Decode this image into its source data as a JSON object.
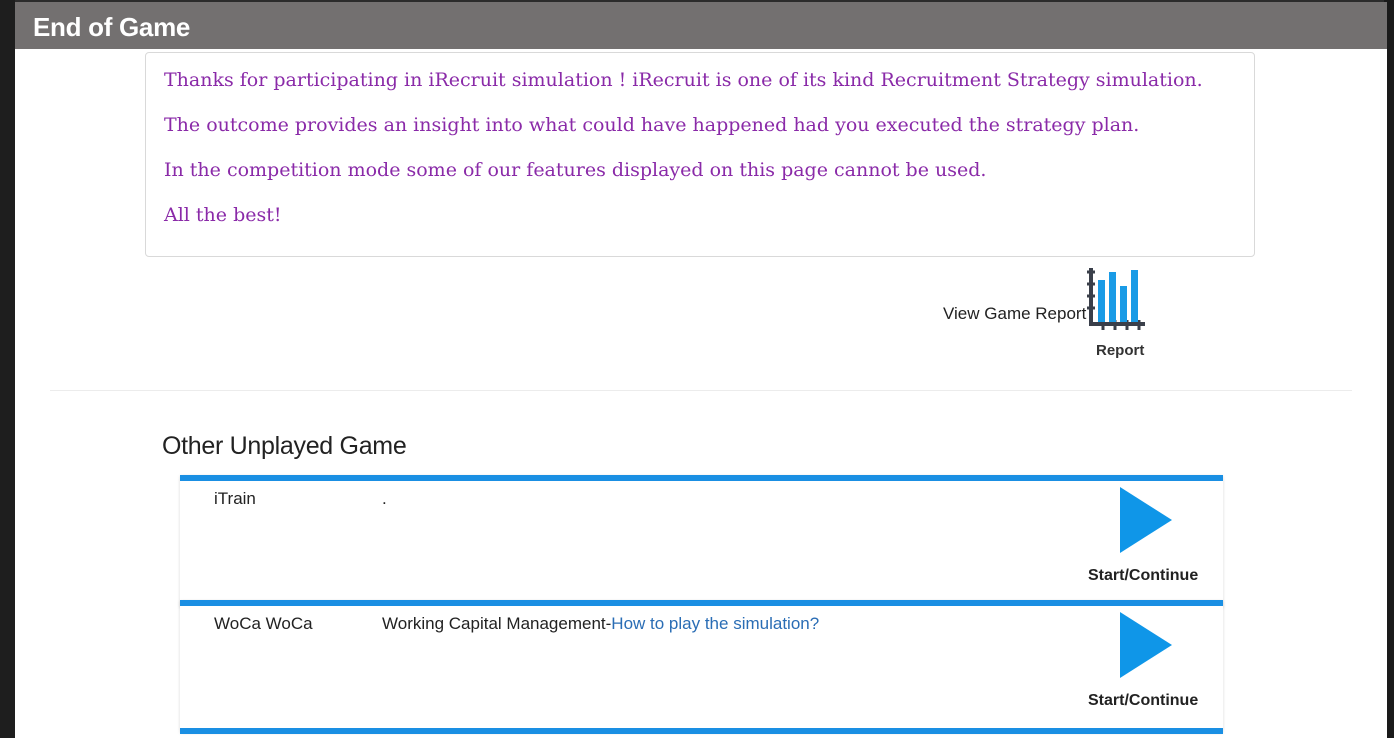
{
  "modal": {
    "title": "End of Game"
  },
  "message": {
    "lines": [
      "Thanks for participating in iRecruit simulation ! iRecruit is one of its kind Recruitment Strategy simulation.",
      "The outcome provides an insight into what could have happened had you executed the strategy plan.",
      "In the competition mode some of our features displayed on this page cannot be used.",
      "All the best!"
    ]
  },
  "report": {
    "link_text": "View Game Report",
    "icon_label": "Report",
    "icon": "bar-chart-icon"
  },
  "other_games": {
    "section_title": "Other Unplayed Game",
    "games": [
      {
        "name": "iTrain",
        "description": ".",
        "help_link": "",
        "action_label": "Start/Continue",
        "icon": "play-icon"
      },
      {
        "name": "WoCa WoCa",
        "description": "Working Capital Management-",
        "help_link": "How to play the simulation?",
        "action_label": "Start/Continue",
        "icon": "play-icon"
      }
    ]
  },
  "colors": {
    "header_bg": "#737070",
    "message_text": "#8a2aa8",
    "accent_blue": "#1a8fe3",
    "link_blue": "#2a6db5"
  }
}
